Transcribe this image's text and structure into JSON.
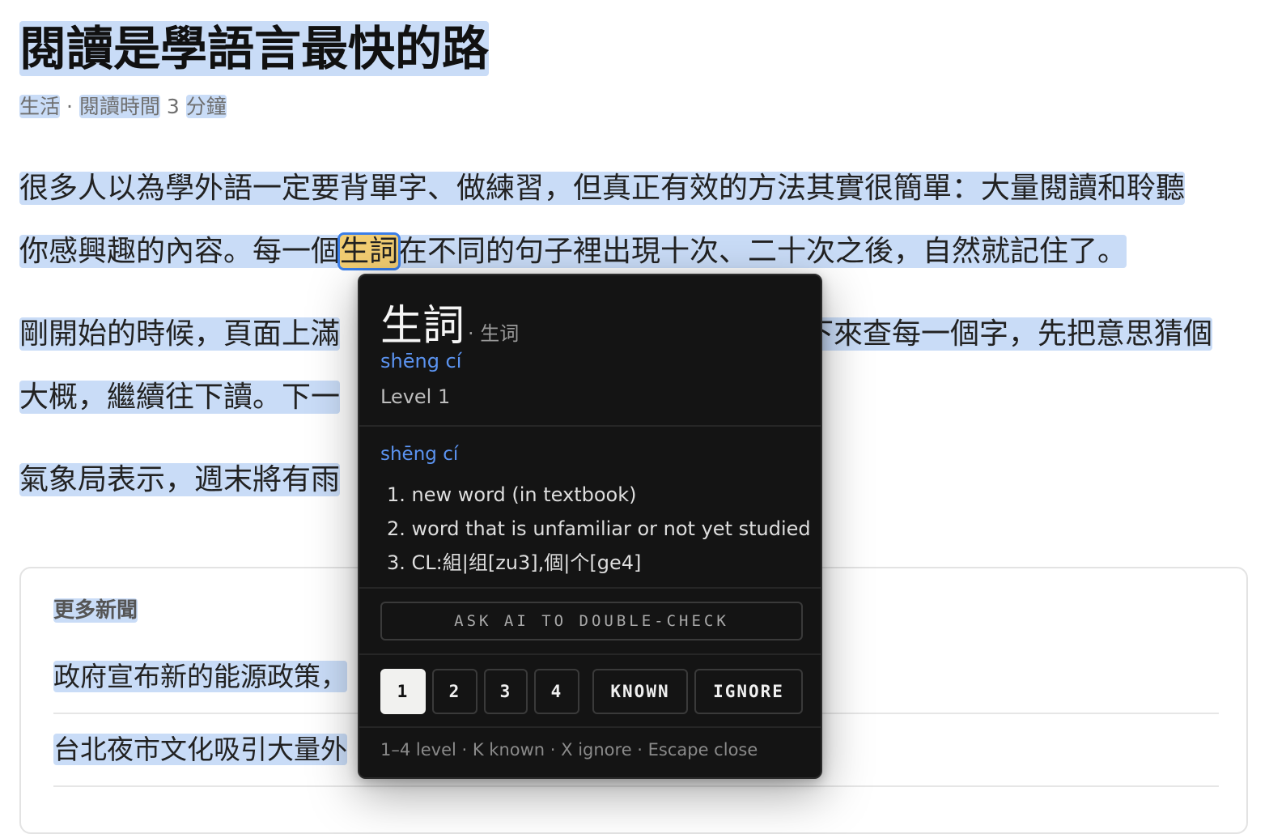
{
  "article": {
    "title": "閱讀是學語言最快的路",
    "meta": {
      "category": "生活",
      "sep1": " · ",
      "reading_label": "閱讀時間",
      "reading_count": " 3 ",
      "minutes_label": "分鐘"
    },
    "paragraphs": [
      {
        "lines": [
          "很多人以為學外語一定要背單字、做練習，但真正有效的方法其實很簡單：大量閱讀和聆聽",
          [
            "你感興趣的內容。每一個",
            "生詞",
            "在不同的句子裡出現十次、二十次之後，自然就記住了。"
          ]
        ]
      },
      {
        "lines": [
          [
            "剛開始的時候，頁面上滿",
            "下來查每一個字，先把意思猜個"
          ],
          [
            "大概，繼續往下讀。下一",
            "。"
          ]
        ]
      },
      {
        "lines": [
          [
            "氣象局表示，週末將有雨",
            "。"
          ]
        ]
      }
    ]
  },
  "more_news": {
    "title": "更多新聞",
    "items": [
      "政府宣布新的能源政策，",
      "台北夜市文化吸引大量外"
    ]
  },
  "popup": {
    "hanzi": "生詞",
    "simplified": "· 生词",
    "pinyin": "shēng cí",
    "level": "Level 1",
    "def_pinyin": "shēng cí",
    "definitions": [
      "1. new word (in textbook)",
      "2. word that is unfamiliar or not yet studied",
      "3. CL:組|组[zu3],個|个[ge4]"
    ],
    "ask_ai": "ASK AI TO DOUBLE-CHECK",
    "levels": [
      "1",
      "2",
      "3",
      "4"
    ],
    "selected_level": "1",
    "known": "KNOWN",
    "ignore": "IGNORE",
    "footer": "1–4 level · K known · X ignore · Escape close"
  },
  "colors": {
    "word_highlight": "#c9dcf7",
    "active_word": "#f2cd72",
    "active_outline": "#3b7ee8",
    "popup_bg": "#141414",
    "pinyin": "#5b93f0"
  }
}
